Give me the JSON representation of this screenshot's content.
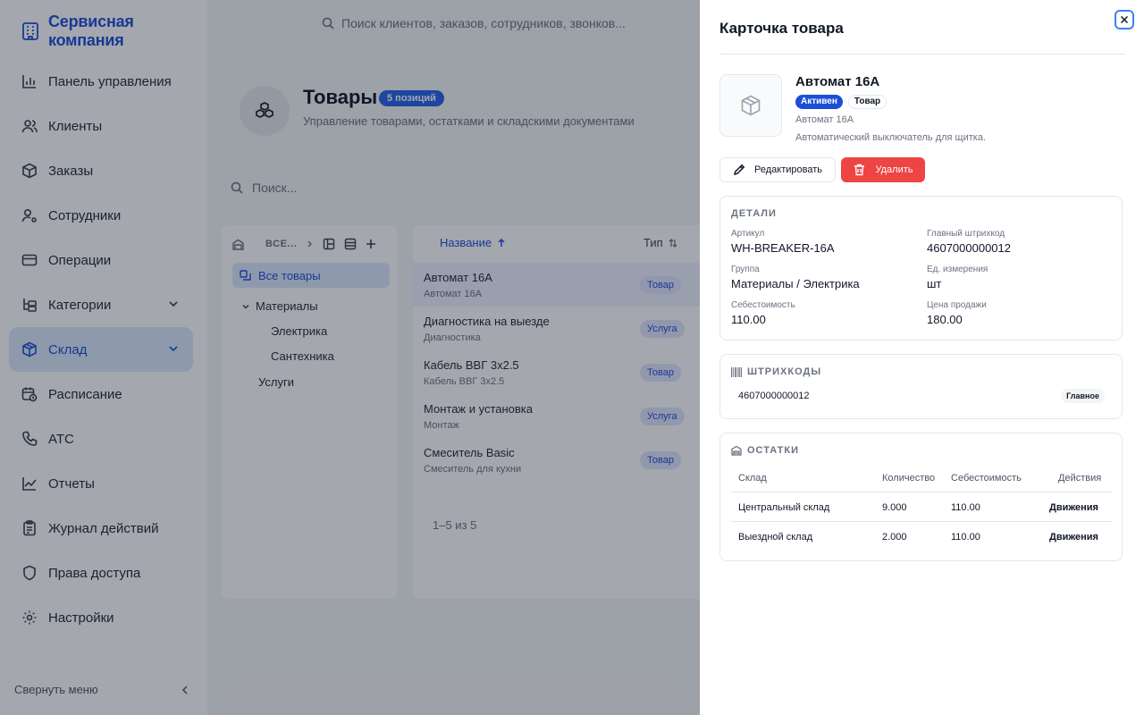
{
  "app": {
    "brand": "Сервисная компания",
    "top_search_placeholder": "Поиск клиентов, заказов, сотрудников, звонков...",
    "nav": [
      {
        "label": "Панель управления",
        "icon": "bar-chart-icon"
      },
      {
        "label": "Клиенты",
        "icon": "users-icon"
      },
      {
        "label": "Заказы",
        "icon": "box-icon"
      },
      {
        "label": "Сотрудники",
        "icon": "user-gear-icon"
      },
      {
        "label": "Операции",
        "icon": "card-icon"
      },
      {
        "label": "Категории",
        "icon": "category-icon"
      },
      {
        "label": "Склад",
        "icon": "package-icon"
      },
      {
        "label": "Расписание",
        "icon": "calendar-clock-icon"
      },
      {
        "label": "АТС",
        "icon": "phone-icon"
      },
      {
        "label": "Отчеты",
        "icon": "line-chart-icon"
      },
      {
        "label": "Журнал действий",
        "icon": "clipboard-icon"
      },
      {
        "label": "Права доступа",
        "icon": "shield-icon"
      },
      {
        "label": "Настройки",
        "icon": "gear-icon"
      }
    ],
    "collapse_label": "Свернуть меню"
  },
  "page": {
    "title": "Товары",
    "count_badge": "5 позиций",
    "subtitle": "Управление товарами, остатками и складскими документами",
    "search_placeholder": "Поиск...",
    "tree": {
      "toolbar_label": "ВСЕ...",
      "all": "Все товары",
      "materials": "Материалы",
      "electric": "Электрика",
      "plumbing": "Сантехника",
      "services": "Услуги"
    },
    "table": {
      "col_name": "Название",
      "col_type": "Тип",
      "rows": [
        {
          "name": "Автомат 16А",
          "sub": "Автомат 16А",
          "type": "Товар"
        },
        {
          "name": "Диагностика на выезде",
          "sub": "Диагностика",
          "type": "Услуга"
        },
        {
          "name": "Кабель ВВГ 3х2.5",
          "sub": "Кабель ВВГ 3х2.5",
          "type": "Товар"
        },
        {
          "name": "Монтаж и установка",
          "sub": "Монтаж",
          "type": "Услуга"
        },
        {
          "name": "Смеситель Basic",
          "sub": "Смеситель для кухни",
          "type": "Товар"
        }
      ],
      "pagination": "1–5 из 5"
    }
  },
  "drawer": {
    "title": "Карточка товара",
    "product": {
      "name": "Автомат 16А",
      "status": "Активен",
      "kind": "Товар",
      "subname": "Автомат 16А",
      "description": "Автоматический выключатель для щитка."
    },
    "edit_label": "Редактировать",
    "delete_label": "Удалить",
    "details": {
      "title": "ДЕТАЛИ",
      "sku_label": "Артикул",
      "sku": "WH-BREAKER-16A",
      "barcode_label": "Главный штрихкод",
      "barcode": "4607000000012",
      "group_label": "Группа",
      "group": "Материалы / Электрика",
      "unit_label": "Ед. измерения",
      "unit": "шт",
      "cost_label": "Себестоимость",
      "cost": "110.00",
      "price_label": "Цена продажи",
      "price": "180.00"
    },
    "barcodes": {
      "title": "ШТРИХКОДЫ",
      "items": [
        {
          "code": "4607000000012",
          "badge": "Главное"
        }
      ]
    },
    "stock": {
      "title": "ОСТАТКИ",
      "headers": {
        "warehouse": "Склад",
        "qty": "Количество",
        "cost": "Себестоимость",
        "actions": "Действия"
      },
      "rows": [
        {
          "warehouse": "Центральный склад",
          "qty": "9.000",
          "cost": "110.00",
          "action": "Движения"
        },
        {
          "warehouse": "Выездной склад",
          "qty": "2.000",
          "cost": "110.00",
          "action": "Движения"
        }
      ]
    }
  },
  "colors": {
    "accent": "#1d4ed8",
    "danger": "#ef4444",
    "overlay": "#111827"
  }
}
